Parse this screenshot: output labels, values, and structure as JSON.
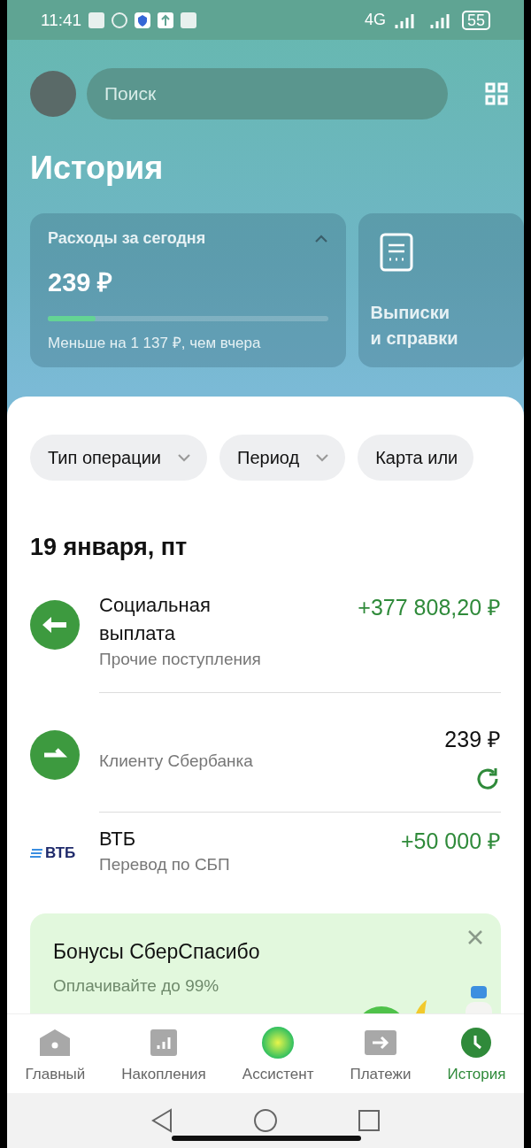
{
  "status_bar": {
    "time": "11:41",
    "network": "4G",
    "battery": "55"
  },
  "header": {
    "search": {
      "placeholder": "Поиск"
    },
    "title": "История"
  },
  "spending": {
    "title": "Расходы за сегодня",
    "amount": "239 ₽",
    "level": 0.17,
    "note": "Меньше на 1 137 ₽, чем вчера",
    "expanded": true
  },
  "statements": {
    "label": "Выписки и справки"
  },
  "filters": [
    {
      "label": "Тип операции",
      "dropdown": true
    },
    {
      "label": "Период",
      "dropdown": true
    },
    {
      "label": "Карта или",
      "dropdown": false
    }
  ],
  "date_heading": "19 января, пт",
  "transactions": [
    {
      "kind": "incoming",
      "title": "Социальная выплата",
      "subtitle": "Прочие поступления",
      "amount": "+377 808,20 ₽",
      "incoming": true,
      "repeat": false
    },
    {
      "kind": "transfer",
      "subtitle": "Клиенту Сбербанка",
      "amount": "239 ₽",
      "incoming": false,
      "repeat": true
    },
    {
      "kind": "bank_logo",
      "logo": "ВТБ",
      "title": "ВТБ",
      "subtitle": "Перевод по СБП",
      "amount": "+50 000 ₽",
      "incoming": true,
      "repeat": false
    }
  ],
  "promo": {
    "title": "Бонусы СберСпасибо",
    "lines": [
      "Оплачивайте до 99%"
    ],
    "kind": "picture"
  },
  "bottom_nav": [
    {
      "label": "Главный",
      "selected": false
    },
    {
      "label": "Накопления",
      "selected": false
    },
    {
      "label": "Ассистент",
      "selected": false
    },
    {
      "label": "Платежи",
      "selected": false
    },
    {
      "label": "История",
      "selected": true
    }
  ]
}
